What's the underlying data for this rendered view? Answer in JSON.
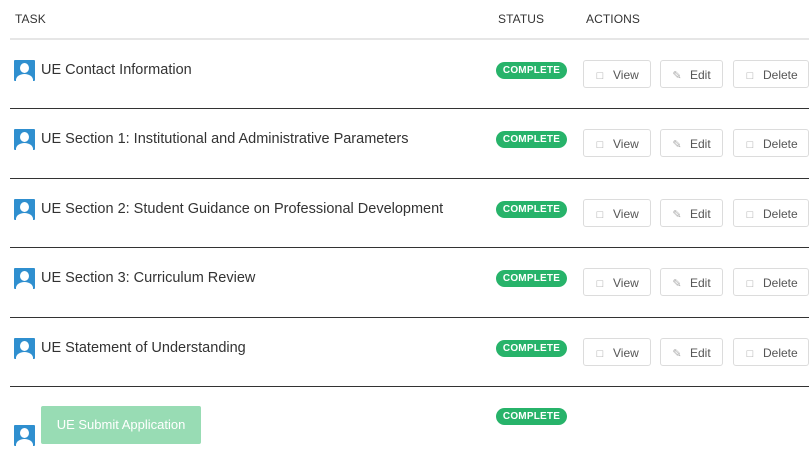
{
  "table": {
    "headers": {
      "task": "TASK",
      "status": "STATUS",
      "actions": "ACTIONS"
    },
    "actions": {
      "view": "View",
      "edit": "Edit",
      "delete": "Delete"
    },
    "rows": [
      {
        "task": "UE Contact Information",
        "status": "COMPLETE"
      },
      {
        "task": "UE Section 1: Institutional and Administrative Parameters",
        "status": "COMPLETE"
      },
      {
        "task": "UE Section 2: Student Guidance on Professional Development",
        "status": "COMPLETE"
      },
      {
        "task": "UE Section 3: Curriculum Review",
        "status": "COMPLETE"
      },
      {
        "task": "UE Statement of Understanding",
        "status": "COMPLETE"
      }
    ],
    "final_row": {
      "button_label": "UE Submit Application",
      "status": "COMPLETE"
    }
  },
  "icons": {
    "avatar": "user-avatar-icon",
    "view": "view-document-icon",
    "edit": "pencil-icon",
    "delete": "trash-icon"
  },
  "colors": {
    "badge": "#27b36a",
    "avatar": "#2f8fcf",
    "submit_disabled": "#98dcb4"
  }
}
